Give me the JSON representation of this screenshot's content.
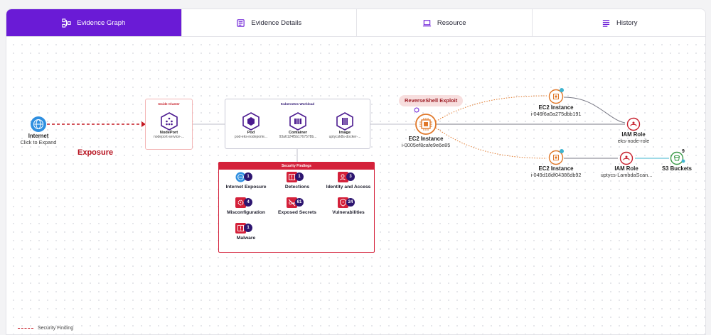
{
  "tabs": [
    {
      "label": "Evidence Graph",
      "active": true,
      "icon": "graph-icon"
    },
    {
      "label": "Evidence Details",
      "active": false,
      "icon": "document-icon"
    },
    {
      "label": "Resource",
      "active": false,
      "icon": "laptop-icon"
    },
    {
      "label": "History",
      "active": false,
      "icon": "list-icon"
    }
  ],
  "colors": {
    "accent": "#6a1bd6",
    "danger": "#d4213a",
    "node_purple": "#4b1a8f",
    "ec2_orange": "#e0782a",
    "iam_red": "#c71f2c",
    "s3_green": "#3a9a48"
  },
  "graph": {
    "internet": {
      "title": "Internet",
      "subtitle": "Click to Expand",
      "icon": "globe-icon"
    },
    "exposure_label": "Exposure",
    "inside_cluster": {
      "title": "Inside Cluster",
      "node": {
        "title": "NodePort",
        "subtitle": "nodeport-service-..."
      }
    },
    "workload": {
      "title": "Kubernetes Workload",
      "items": [
        {
          "title": "Pod",
          "subtitle": "pod-eks-nodeporte..."
        },
        {
          "title": "Container",
          "subtitle": "93a6124f5b1767578b..."
        },
        {
          "title": "Image",
          "subtitle": "uptycsk8s-docker-..."
        }
      ]
    },
    "security_findings": {
      "title": "Security Findings",
      "items": [
        {
          "label": "Internet Exposure",
          "count": "1",
          "icon": "globe-icon"
        },
        {
          "label": "Detections",
          "count": "1",
          "icon": "alert-icon"
        },
        {
          "label": "Identity and Access",
          "count": "3",
          "icon": "identity-icon"
        },
        {
          "label": "Misconfiguration",
          "count": "4",
          "icon": "gear-alert-icon"
        },
        {
          "label": "Exposed Secrets",
          "count": "61",
          "icon": "key-off-icon"
        },
        {
          "label": "Vulnerabilities",
          "count": "24",
          "icon": "shield-alert-icon"
        },
        {
          "label": "Malware",
          "count": "1",
          "icon": "alert-icon"
        }
      ]
    },
    "exploit_label": "ReverseShell Exploit",
    "ec2_main": {
      "title": "EC2 Instance",
      "subtitle": "i-0005ef8cafe9e6e85"
    },
    "ec2_top": {
      "title": "EC2 Instance",
      "subtitle": "i-046f6a0a275dbb191"
    },
    "ec2_bottom": {
      "title": "EC2 Instance",
      "subtitle": "i-049d18df04386db92"
    },
    "iam_top": {
      "title": "IAM Role",
      "subtitle": "eks-node-role"
    },
    "iam_bottom": {
      "title": "IAM Role",
      "subtitle": "uptycs-LambdaScan..."
    },
    "s3": {
      "title": "S3 Buckets",
      "count": "9"
    }
  },
  "legend": {
    "label": "Security Finding"
  }
}
